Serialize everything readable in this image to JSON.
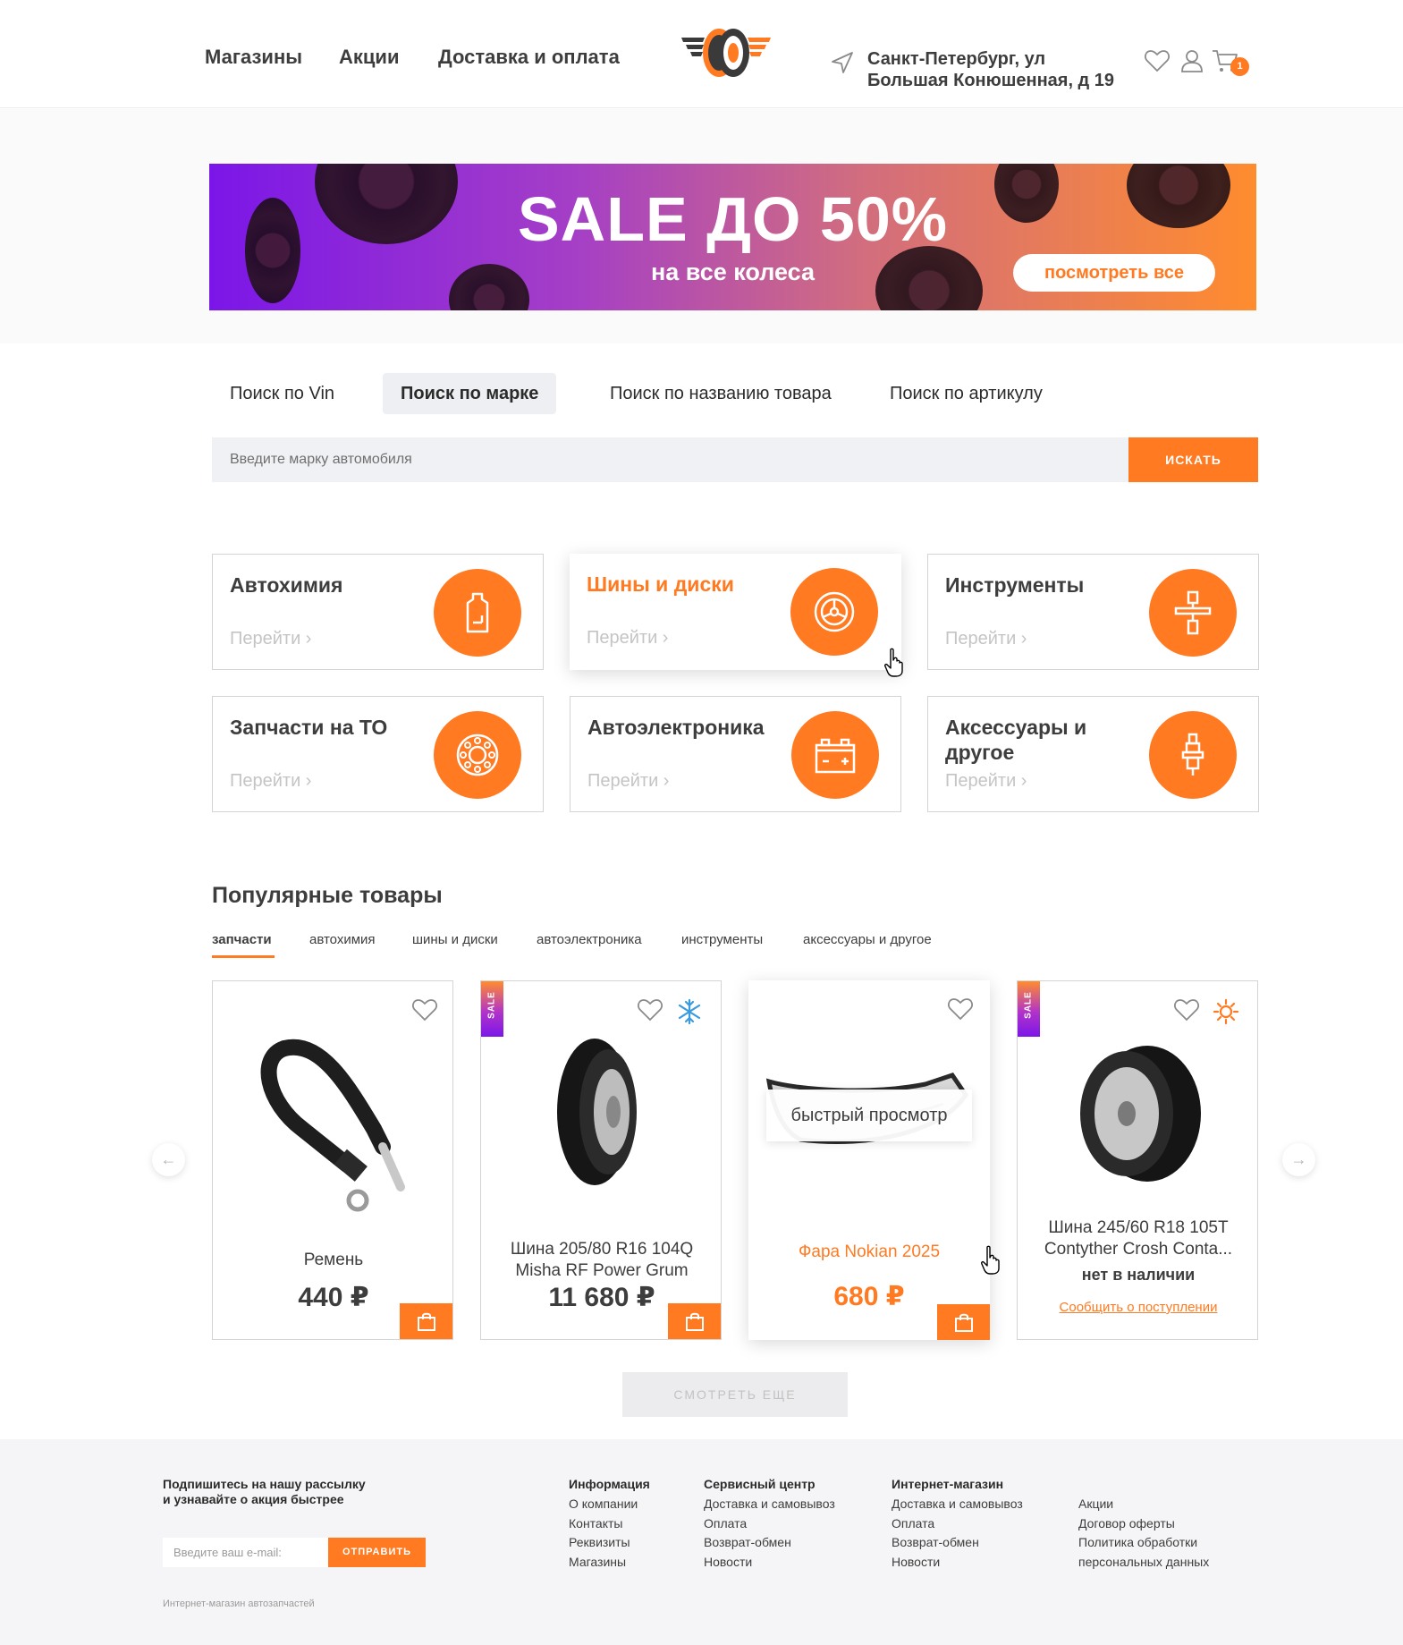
{
  "header": {
    "nav": [
      "Магазины",
      "Акции",
      "Доставка и оплата"
    ],
    "address_line1": "Санкт-Петербург, ул",
    "address_line2": "Большая Конюшенная, д 19",
    "cart_count": "1",
    "icons": [
      "location-arrow-icon",
      "heart-icon",
      "user-icon",
      "cart-icon"
    ]
  },
  "banner": {
    "title": "SALE ДО 50%",
    "subtitle": "на все колеса",
    "button": "посмотреть все"
  },
  "search": {
    "tabs": [
      "Поиск по Vin",
      "Поиск по марке",
      "Поиск по названию товара",
      "Поиск по артикулу"
    ],
    "active_tab": "Поиск по марке",
    "placeholder": "Введите марку автомобиля",
    "button": "ИСКАТЬ"
  },
  "categories": [
    {
      "title": "Автохимия",
      "link": "Перейти",
      "icon": "oil-canister-icon"
    },
    {
      "title": "Шины и диски",
      "link": "Перейти",
      "icon": "wheel-icon"
    },
    {
      "title": "Инструменты",
      "link": "Перейти",
      "icon": "shock-absorber-icon"
    },
    {
      "title": "Запчасти на ТО",
      "link": "Перейти",
      "icon": "bearing-icon"
    },
    {
      "title": "Автоэлектроника",
      "link": "Перейти",
      "icon": "battery-icon"
    },
    {
      "title": "Аксессуары и другое",
      "link": "Перейти",
      "icon": "spark-plug-icon"
    }
  ],
  "popular": {
    "title": "Популярные товары",
    "tabs": [
      "запчасти",
      "автохимия",
      "шины и диски",
      "автоэлектроника",
      "инструменты",
      "аксессуары и другое"
    ],
    "active_tab": "запчасти",
    "products": [
      {
        "name": "Ремень",
        "price": "440 ₽",
        "sale": false
      },
      {
        "name_line1": "Шина 205/80 R16 104Q",
        "name_line2": "Misha RF Power Grum",
        "price": "11 680 ₽",
        "sale": true,
        "sale_label": "SALE",
        "season": "winter-snowflake-icon"
      },
      {
        "name": "Фара Nokian 2025",
        "price": "680 ₽",
        "sale": false,
        "quick_view": "быстрый просмотр"
      },
      {
        "name_line1": "Шина 245/60 R18 105T",
        "name_line2": "Contyther Crosh Conta...",
        "sale": true,
        "sale_label": "SALE",
        "season": "summer-sun-icon",
        "availability": "нет в наличии",
        "notify": "Сообщить о поступлении"
      }
    ],
    "more_button": "СМОТРЕТЬ ЕЩЕ"
  },
  "footer": {
    "subscribe_line1": "Подпишитесь на нашу рассылку",
    "subscribe_line2": "и узнавайте о акция быстрее",
    "email_placeholder": "Введите ваш e-mail:",
    "send_button": "ОТПРАВИТЬ",
    "copyright": "Интернет-магазин автозапчастей",
    "columns": [
      {
        "heading": "Информация",
        "links": [
          "О компании",
          "Контакты",
          "Реквизиты",
          "Магазины"
        ]
      },
      {
        "heading": "Сервисный центр",
        "links": [
          "Доставка и самовывоз",
          "Оплата",
          "Возврат-обмен",
          "Новости"
        ]
      },
      {
        "heading": "Интернет-магазин",
        "links": [
          "Доставка и самовывоз",
          "Оплата",
          "Возврат-обмен",
          "Новости"
        ]
      },
      {
        "heading": "",
        "links": [
          "Акции",
          "Договор оферты",
          "Политика обработки",
          "персональных данных"
        ]
      }
    ]
  },
  "colors": {
    "accent": "#ff7a21",
    "text": "#3d3d3d",
    "banner_start": "#7b16e8",
    "banner_end": "#ff8c2e"
  }
}
